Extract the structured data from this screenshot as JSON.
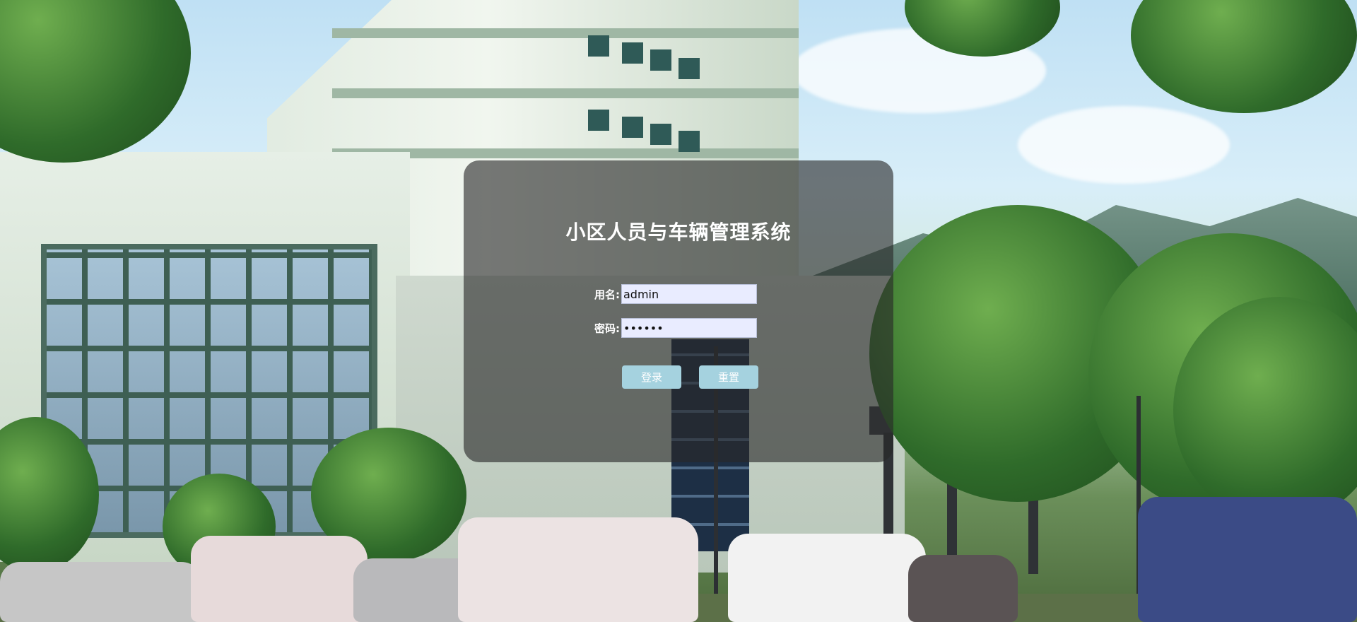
{
  "app": {
    "title": "小区人员与车辆管理系统"
  },
  "login": {
    "username_label": "用名:",
    "username_value": "admin",
    "password_label": "密码:",
    "password_value": "••••••",
    "submit_label": "登录",
    "reset_label": "重置"
  },
  "colors": {
    "panel_overlay": "rgba(40,40,40,0.62)",
    "button_bg": "#a5d2df",
    "input_bg": "#e9ecff"
  }
}
